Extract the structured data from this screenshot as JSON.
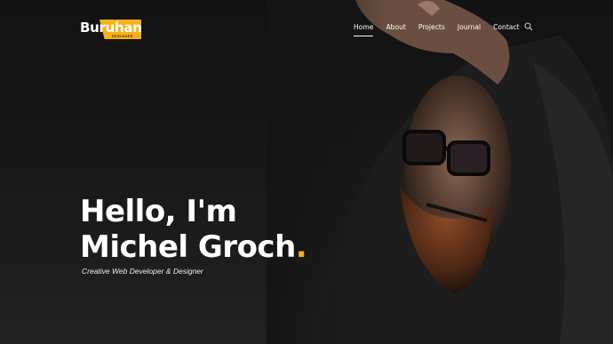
{
  "brand": {
    "name": "Buruhan",
    "tagline": "DESIGNER",
    "accent_color": "#f4b21a"
  },
  "nav": {
    "items": [
      {
        "label": "Home",
        "active": true
      },
      {
        "label": "About",
        "active": false
      },
      {
        "label": "Projects",
        "active": false
      },
      {
        "label": "Journal",
        "active": false
      },
      {
        "label": "Contact",
        "active": false
      }
    ],
    "search_icon": "search-icon"
  },
  "hero": {
    "headline_line1": "Hello, I'm",
    "headline_line2": "Michel Groch",
    "headline_dot": ".",
    "subtitle": "Creative Web Developer & Designer",
    "background_color": "#151515"
  }
}
